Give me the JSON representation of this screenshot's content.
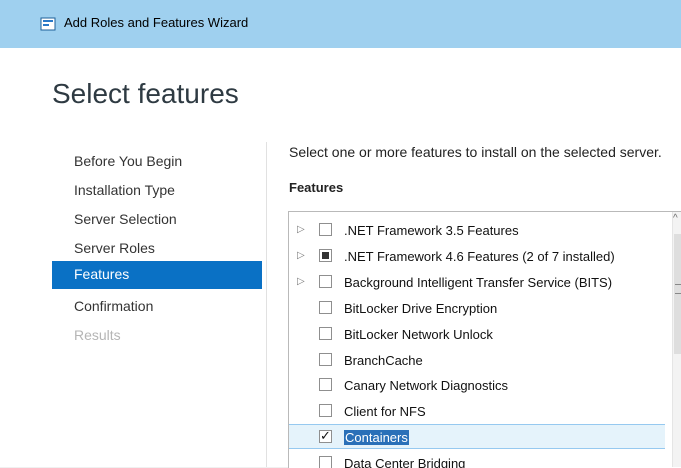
{
  "window": {
    "title": "Add Roles and Features Wizard"
  },
  "page": {
    "heading": "Select features",
    "intro": "Select one or more features to install on the selected server.",
    "features_label": "Features"
  },
  "nav": {
    "items": [
      {
        "label": "Before You Begin",
        "state": "normal"
      },
      {
        "label": "Installation Type",
        "state": "normal"
      },
      {
        "label": "Server Selection",
        "state": "normal"
      },
      {
        "label": "Server Roles",
        "state": "normal"
      },
      {
        "label": "Features",
        "state": "active"
      },
      {
        "label": "Confirmation",
        "state": "normal"
      },
      {
        "label": "Results",
        "state": "disabled"
      }
    ]
  },
  "features": [
    {
      "label": ".NET Framework 3.5 Features",
      "expandable": true,
      "check": "unchecked"
    },
    {
      "label": ".NET Framework 4.6 Features (2 of 7 installed)",
      "expandable": true,
      "check": "partial"
    },
    {
      "label": "Background Intelligent Transfer Service (BITS)",
      "expandable": true,
      "check": "unchecked"
    },
    {
      "label": "BitLocker Drive Encryption",
      "expandable": false,
      "check": "unchecked"
    },
    {
      "label": "BitLocker Network Unlock",
      "expandable": false,
      "check": "unchecked"
    },
    {
      "label": "BranchCache",
      "expandable": false,
      "check": "unchecked"
    },
    {
      "label": "Canary Network Diagnostics",
      "expandable": false,
      "check": "unchecked"
    },
    {
      "label": "Client for NFS",
      "expandable": false,
      "check": "unchecked"
    },
    {
      "label": "Containers",
      "expandable": false,
      "check": "checked",
      "selected": true
    },
    {
      "label": "Data Center Bridging",
      "expandable": false,
      "check": "unchecked"
    }
  ],
  "icons": {
    "app": "server-wizard-icon",
    "expander": "triangle-right-icon",
    "scroll_up": "chevron-up-icon"
  },
  "colors": {
    "titlebar": "#9fd0ef",
    "nav_active": "#0a71c5",
    "selection": "#2a70b8",
    "row_highlight": "#e5f3fb"
  }
}
